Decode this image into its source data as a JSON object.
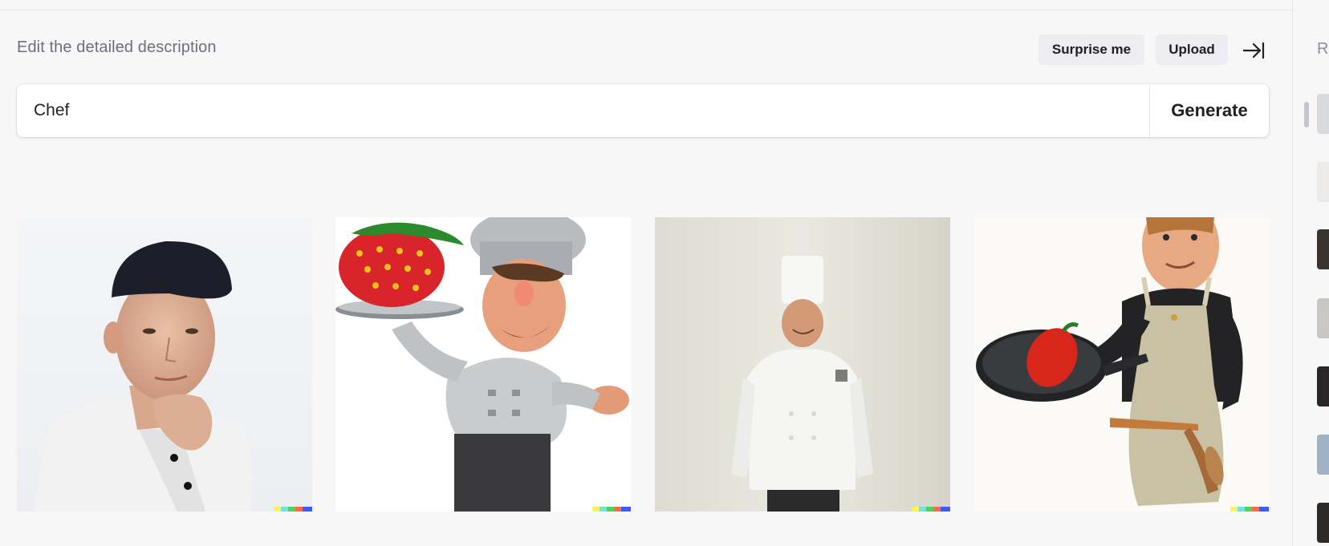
{
  "header": {
    "label": "Edit the detailed description",
    "surprise_label": "Surprise me",
    "upload_label": "Upload"
  },
  "prompt": {
    "value": "Chef",
    "generate_label": "Generate"
  },
  "results": {
    "images": [
      {
        "name": "chef-photo-young-man"
      },
      {
        "name": "chef-cartoon-strawberry"
      },
      {
        "name": "chef-photo-white-hat"
      },
      {
        "name": "chef-cartoon-pan-pepper"
      }
    ]
  },
  "sidebar": {
    "title": "R"
  },
  "colors": {
    "background": "#f7f7f8",
    "button_bg": "#ececf1",
    "text": "#202123",
    "muted": "#6e6e80"
  }
}
